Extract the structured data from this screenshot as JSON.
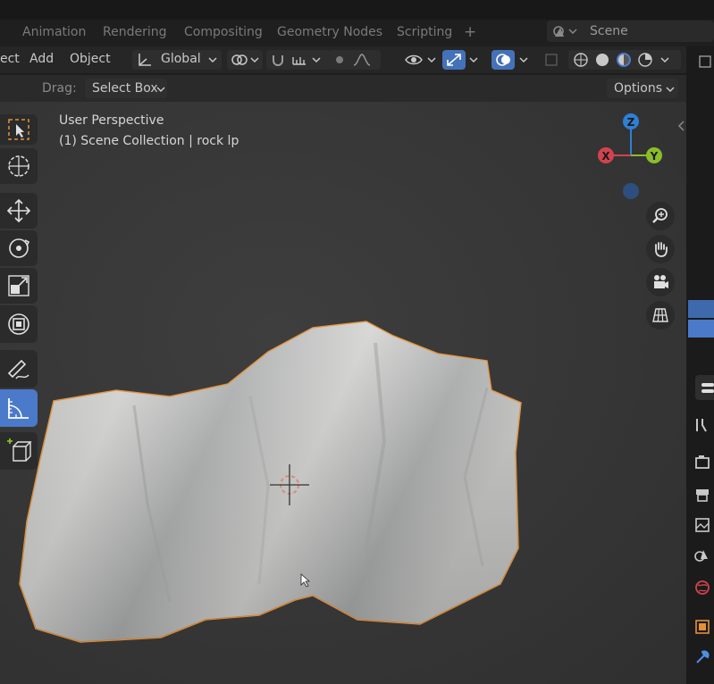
{
  "workspace_tabs": [
    "Animation",
    "Rendering",
    "Compositing",
    "Geometry Nodes",
    "Scripting"
  ],
  "add_workspace_symbol": "+",
  "scene_name": "Scene",
  "header_menus": [
    "ect",
    "Add",
    "Object"
  ],
  "transform_orientation": "Global",
  "drag_label": "Drag:",
  "drag_mode": "Select Box",
  "options_label": "Options",
  "viewport_info": {
    "perspective": "User Perspective",
    "collection": "(1) Scene Collection | rock lp"
  },
  "axis_labels": {
    "x": "X",
    "y": "Y",
    "z": "Z"
  },
  "colors": {
    "x_axis": "#d2434f",
    "y_axis": "#8bbd2a",
    "z_axis": "#2f7fd4",
    "selection_outline": "#e3913a",
    "active_tool": "#4a7ac9"
  },
  "toolbar_icons": [
    "select-box-icon",
    "cursor-icon",
    "move-icon",
    "rotate-icon",
    "scale-icon",
    "transform-icon",
    "annotate-icon",
    "measure-icon",
    "add-cube-icon"
  ],
  "nav_icons": [
    "zoom-icon",
    "hand-icon",
    "camera-icon",
    "grid-icon"
  ]
}
